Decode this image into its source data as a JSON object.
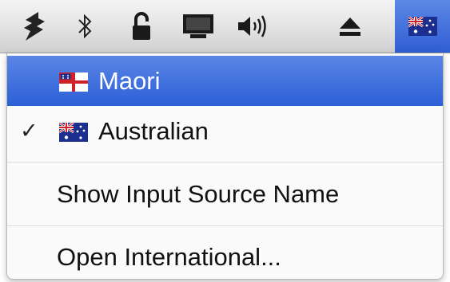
{
  "menubar": {
    "items": [
      {
        "icon": "script-menu-icon"
      },
      {
        "icon": "bluetooth-icon"
      },
      {
        "icon": "lock-icon"
      },
      {
        "icon": "display-icon"
      },
      {
        "icon": "volume-icon"
      },
      {
        "icon": "eject-icon"
      },
      {
        "icon": "australian-flag-icon",
        "active": true
      }
    ]
  },
  "menu": {
    "items": [
      {
        "label": "Maori",
        "flag": "maori-flag-icon",
        "highlighted": true,
        "checked": false
      },
      {
        "label": "Australian",
        "flag": "australian-flag-icon",
        "highlighted": false,
        "checked": true
      },
      {
        "label": "Show Input Source Name"
      },
      {
        "label": "Open International..."
      }
    ],
    "check_glyph": "✓"
  },
  "colors": {
    "highlight": "#3a6ad8",
    "flag_blue": "#1c2f8f",
    "flag_red": "#d0202a"
  }
}
